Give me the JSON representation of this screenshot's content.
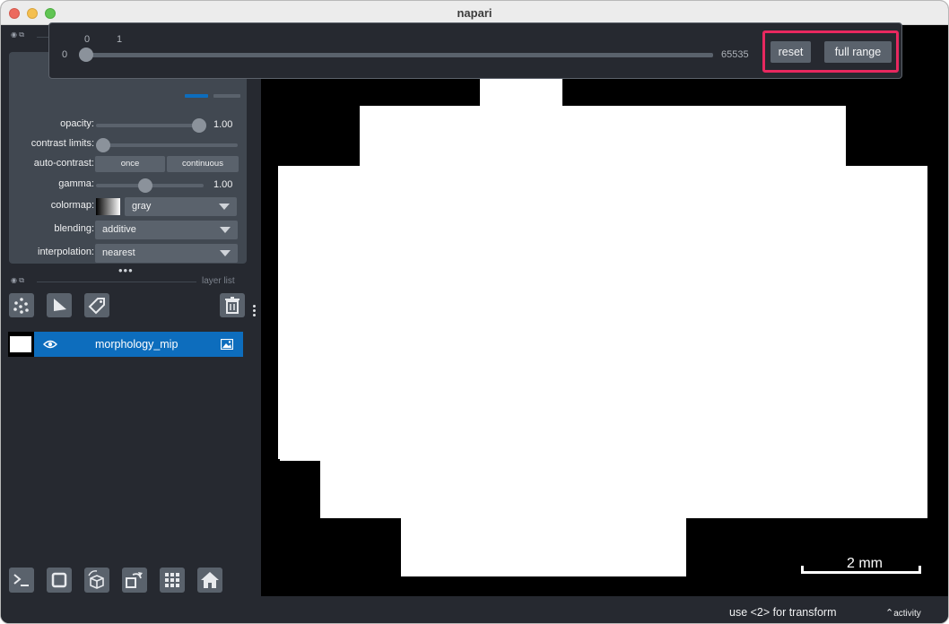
{
  "window": {
    "title": "napari"
  },
  "contrast_popup": {
    "range_min": "0",
    "range_max": "65535",
    "tick_low": "0",
    "tick_high": "1",
    "reset_label": "reset",
    "full_range_label": "full range",
    "highlight_color": "#e8285f"
  },
  "layer_controls": {
    "opacity": {
      "label": "opacity:",
      "value": "1.00",
      "level": 1.0
    },
    "contrast_limits": {
      "label": "contrast limits:"
    },
    "auto_contrast": {
      "label": "auto-contrast:",
      "once_label": "once",
      "continuous_label": "continuous"
    },
    "gamma": {
      "label": "gamma:",
      "value": "1.00"
    },
    "colormap": {
      "label": "colormap:",
      "value": "gray"
    },
    "blending": {
      "label": "blending:",
      "value": "additive"
    },
    "interpolation": {
      "label": "interpolation:",
      "value": "nearest"
    }
  },
  "layer_list": {
    "header": "layer list",
    "tools": [
      "points-icon",
      "shapes-icon",
      "labels-icon",
      "delete-icon"
    ],
    "layers": [
      {
        "name": "morphology_mip",
        "visible": true,
        "type_icon": "image-icon",
        "selected": true
      }
    ]
  },
  "viewer_buttons": [
    "console-icon",
    "square-icon",
    "3d-cube-icon",
    "rotate-icon",
    "grid-icon",
    "home-icon"
  ],
  "canvas": {
    "scale_bar": "2 mm"
  },
  "status": {
    "message": "use <2> for transform",
    "activity_label": "activity"
  },
  "colors": {
    "accent": "#0d6dbd",
    "background": "#262930",
    "panel": "#414851",
    "button": "#5a626c"
  }
}
